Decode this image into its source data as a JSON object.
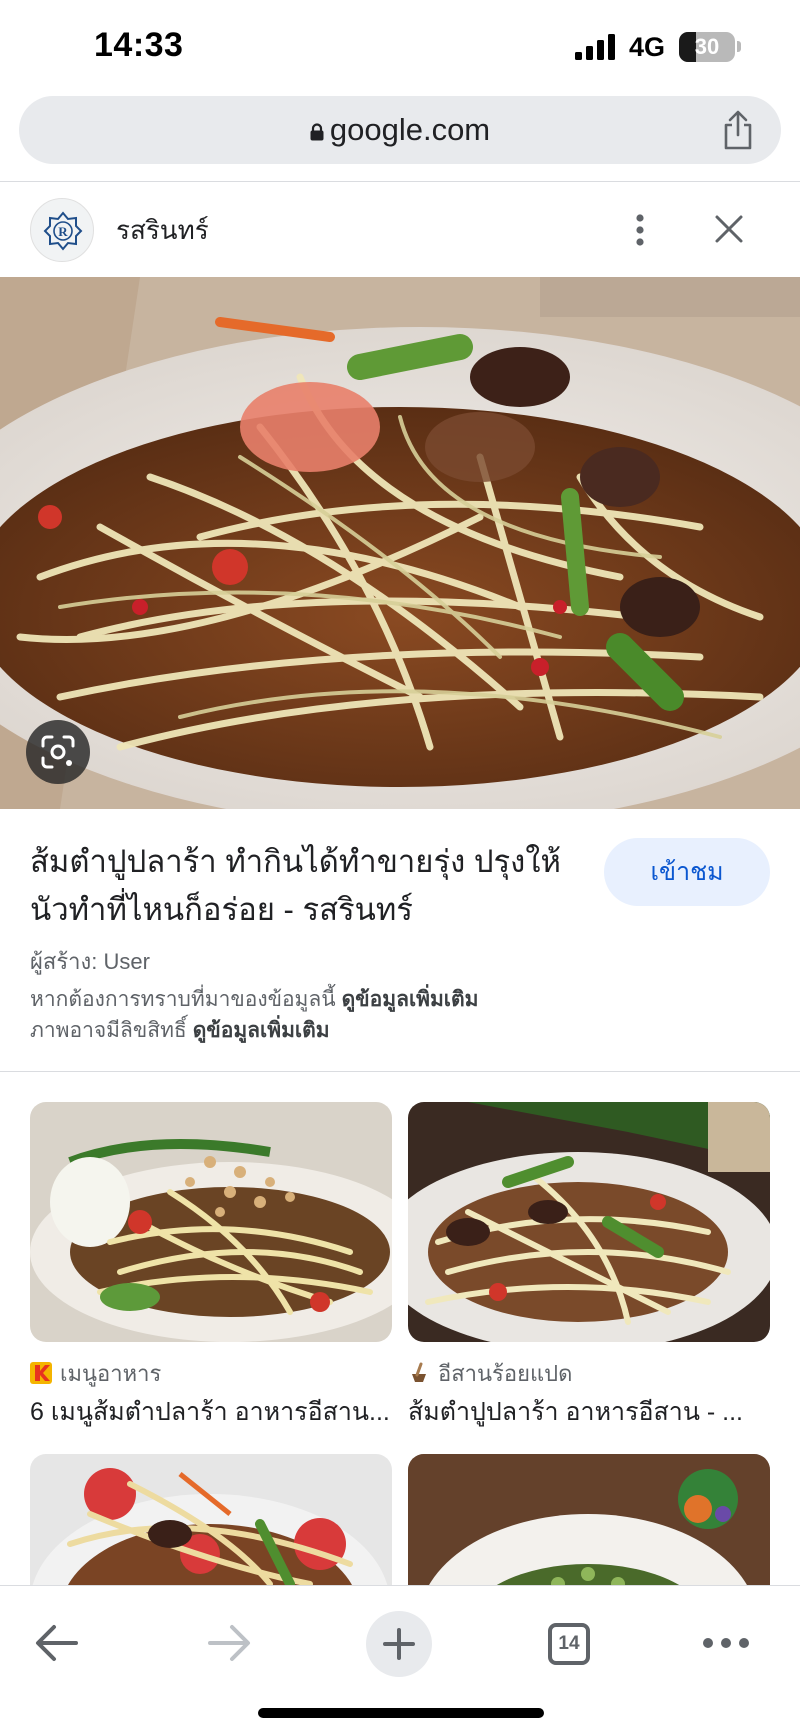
{
  "status_bar": {
    "time": "14:33",
    "network": "4G",
    "battery_level": "30",
    "battery_fraction": 0.3
  },
  "browser": {
    "url": "google.com",
    "lock_icon": "lock-icon",
    "share_icon": "share-icon"
  },
  "source": {
    "name": "รสรินทร์",
    "logo_icon": "rosarin-logo-icon"
  },
  "result": {
    "title": "ส้มตำปูปลาร้า ทำกินได้ทำขายรุ่ง ปรุงให้นัวทำที่ไหนก็อร่อย - รสรินทร์",
    "visit_label": "เข้าชม",
    "creator": "ผู้สร้าง: User",
    "info_line_1": "หากต้องการทราบที่มาของข้อมูลนี้",
    "info_line_1_link": "ดูข้อมูลเพิ่มเติม",
    "info_line_2": "ภาพอาจมีลิขสิทธิ์",
    "info_line_2_link": "ดูข้อมูลเพิ่มเติม"
  },
  "related": [
    {
      "source": "เมนูอาหาร",
      "title": "6 เมนูส้มตำปลาร้า อาหารอีสาน...",
      "source_icon": "k-logo-icon"
    },
    {
      "source": "อีสานร้อยแปด",
      "title": "ส้มตำปูปลาร้า อาหารอีสาน - ...",
      "source_icon": "mortar-logo-icon"
    },
    {
      "source": "",
      "title": ""
    },
    {
      "source": "",
      "title": ""
    }
  ],
  "toolbar": {
    "tab_count": "14",
    "back_icon": "arrow-left-icon",
    "forward_icon": "arrow-right-icon",
    "new_tab_icon": "plus-icon",
    "menu_icon": "more-horizontal-icon"
  },
  "colors": {
    "accent_blue": "#0b57d0",
    "visit_bg": "#e8f0fe",
    "url_bar_bg": "#e8eaed"
  }
}
